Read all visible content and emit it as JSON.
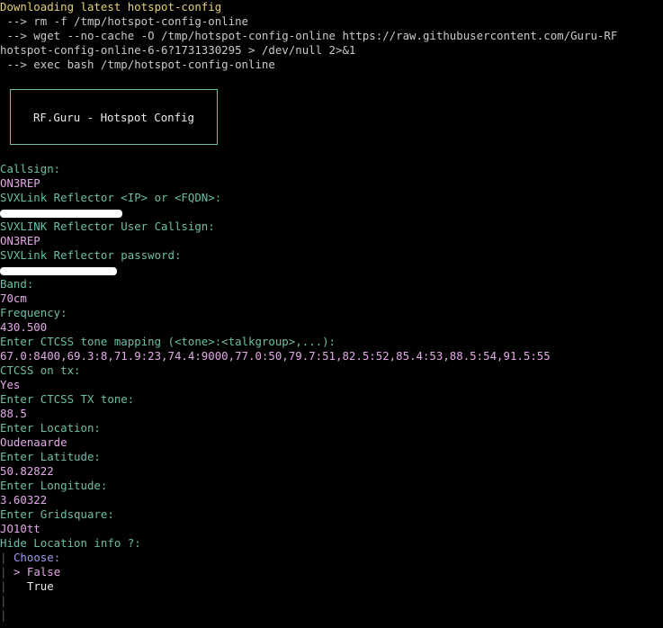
{
  "terminal": {
    "header_lines": [
      "Downloading latest hotspot-config",
      " --> rm -f /tmp/hotspot-config-online",
      " --> wget --no-cache -O /tmp/hotspot-config-online https://raw.githubusercontent.com/Guru-RF",
      "hotspot-config-online-6-6?1731330295 > /dev/null 2>&1",
      " --> exec bash /tmp/hotspot-config-online"
    ],
    "title_box": "RF.Guru - Hotspot Config",
    "prompts": [
      {
        "label": "Callsign:",
        "value": "ON3REP",
        "redacted": false
      },
      {
        "label": "SVXLink Reflector <IP> or <FQDN>:",
        "value": "",
        "redacted": true
      },
      {
        "label": "SVXLINK Reflector User Callsign:",
        "value": "ON3REP",
        "redacted": false
      },
      {
        "label": "SVXLink Reflector password:",
        "value": "",
        "redacted": true
      },
      {
        "label": "Band:",
        "value": "70cm",
        "redacted": false
      },
      {
        "label": "Frequency:",
        "value": "430.500",
        "redacted": false
      },
      {
        "label": "Enter CTCSS tone mapping (<tone>:<talkgroup>,...):",
        "value": "67.0:8400,69.3:8,71.9:23,74.4:9000,77.0:50,79.7:51,82.5:52,85.4:53,88.5:54,91.5:55",
        "redacted": false
      },
      {
        "label": "CTCSS on tx:",
        "value": "Yes",
        "redacted": false
      },
      {
        "label": "Enter CTCSS TX tone:",
        "value": "88.5",
        "redacted": false
      },
      {
        "label": "Enter Location:",
        "value": "Oudenaarde",
        "redacted": false
      },
      {
        "label": "Enter Latitude:",
        "value": "50.82822",
        "redacted": false
      },
      {
        "label": "Enter Longitude:",
        "value": "3.60322",
        "redacted": false
      },
      {
        "label": "Enter Gridsquare:",
        "value": "JO10tt",
        "redacted": false
      }
    ],
    "current_question": "Hide Location info ?:",
    "chooser": {
      "bar": "|",
      "heading": "Choose:",
      "cursor": ">",
      "options": [
        "False",
        "True"
      ],
      "selected_index": 0
    },
    "colors": {
      "header": "#e5d173",
      "command": "#c9c9c9",
      "label": "#6ebda8",
      "value": "#e2a9e6",
      "choose": "#9f98f0",
      "background": "#000000"
    }
  }
}
